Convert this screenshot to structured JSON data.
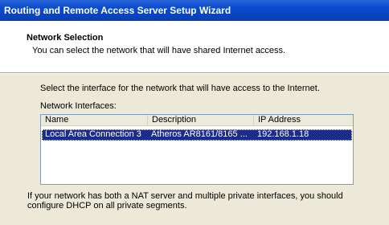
{
  "window": {
    "title": "Routing and Remote Access Server Setup Wizard"
  },
  "header": {
    "title": "Network Selection",
    "subtitle": "You can select the network that will have shared Internet access."
  },
  "content": {
    "prompt": "Select the interface for the network that will have access to the Internet.",
    "list_label": "Network Interfaces:",
    "columns": [
      "Name",
      "Description",
      "IP Address"
    ],
    "rows": [
      {
        "name": "Local Area Connection 3",
        "description": "Atheros AR8161/8165 ...",
        "ip": "192.168.1.18",
        "selected": true
      }
    ],
    "footnote": "If your network has both a NAT server and multiple private interfaces, you should configure DHCP on all private segments."
  },
  "colors": {
    "titlebar": "#0a4bd0",
    "selection": "#1c2c8a",
    "dialog_bg": "#ece9d8"
  }
}
